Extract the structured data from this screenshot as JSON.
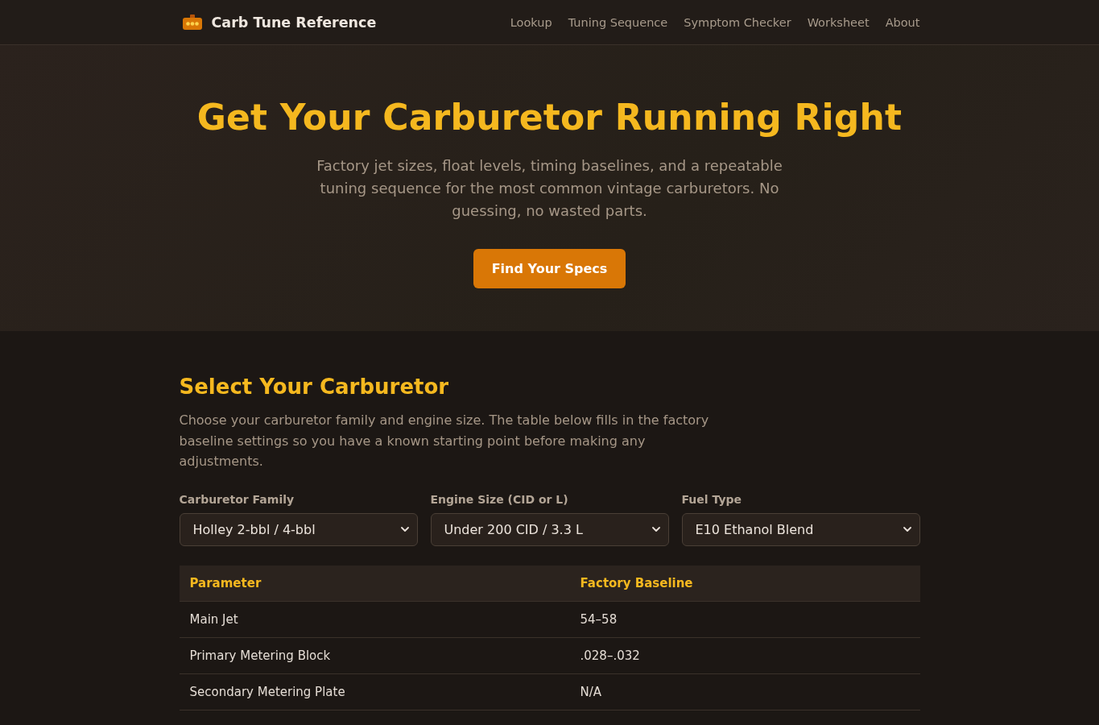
{
  "header": {
    "brand": "Carb Tune Reference",
    "nav": [
      "Lookup",
      "Tuning Sequence",
      "Symptom Checker",
      "Worksheet",
      "About"
    ]
  },
  "hero": {
    "title": "Get Your Carburetor Running Right",
    "subtitle": "Factory jet sizes, float levels, timing baselines, and a repeatable tuning sequence for the most common vintage carburetors. No guessing, no wasted parts.",
    "button": "Find Your Specs"
  },
  "selector": {
    "heading": "Select Your Carburetor",
    "description": "Choose your carburetor family and engine size. The table below fills in the factory baseline settings so you have a known starting point before making any adjustments.",
    "fields": [
      {
        "label": "Carburetor Family",
        "value": "Holley 2-bbl / 4-bbl"
      },
      {
        "label": "Engine Size (CID or L)",
        "value": "Under 200 CID / 3.3 L"
      },
      {
        "label": "Fuel Type",
        "value": "E10 Ethanol Blend"
      }
    ]
  },
  "table": {
    "columns": [
      "Parameter",
      "Factory Baseline"
    ],
    "rows": [
      [
        "Main Jet",
        "54–58"
      ],
      [
        "Primary Metering Block",
        ".028–.032"
      ],
      [
        "Secondary Metering Plate",
        "N/A"
      ]
    ]
  }
}
